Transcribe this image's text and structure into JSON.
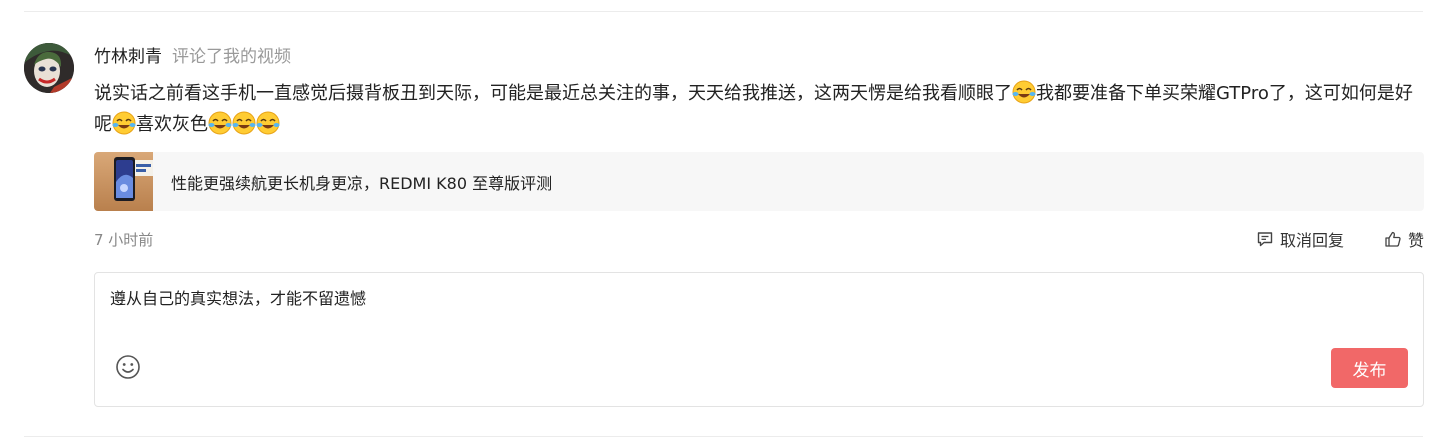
{
  "comment": {
    "username": "竹林刺青",
    "action": "评论了我的视频",
    "body_part1": "说实话之前看这手机一直感觉后摄背板丑到天际，可能是最近总关注的事，天天给我推送，这两天愣是给我看顺眼了",
    "body_part2": "我都要准备下单买荣耀GTPro了，这可如何是好呢",
    "body_part3": "喜欢灰色",
    "emoji_icon": "laughing-tears-emoji",
    "timestamp": "7 小时前",
    "actions": {
      "reply_label": "取消回复",
      "like_label": "赞"
    }
  },
  "video": {
    "title": "性能更强续航更长机身更凉，REDMI K80 至尊版评测"
  },
  "reply_box": {
    "text": "遵从自己的真实想法，才能不留遗憾",
    "publish_label": "发布"
  },
  "colors": {
    "publish_button": "#f16868",
    "secondary_text": "#999999",
    "card_background": "#f7f7f7"
  }
}
